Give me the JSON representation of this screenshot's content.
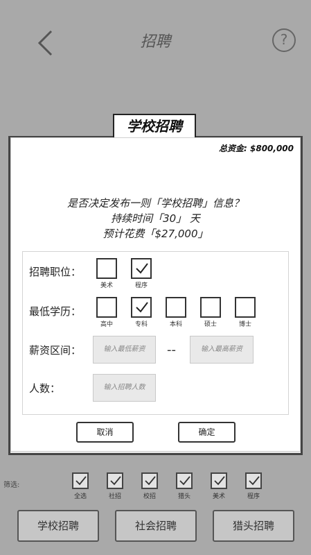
{
  "header": {
    "title": "招聘"
  },
  "dialog": {
    "tab_title": "学校招聘",
    "funds": "总资金: $800,000",
    "question_lines": [
      "是否决定发布一则「学校招聘」信息？",
      "持续时间「30」 天",
      "预计花费「$27,000」"
    ],
    "position": {
      "label": "招聘职位：",
      "options": [
        {
          "label": "美术",
          "checked": false
        },
        {
          "label": "程序",
          "checked": true
        }
      ]
    },
    "education": {
      "label": "最低学历：",
      "options": [
        {
          "label": "高中",
          "checked": false
        },
        {
          "label": "专科",
          "checked": true
        },
        {
          "label": "本科",
          "checked": false
        },
        {
          "label": "硕士",
          "checked": false
        },
        {
          "label": "博士",
          "checked": false
        }
      ]
    },
    "salary": {
      "label": "薪资区间：",
      "min_placeholder": "输入最低薪资",
      "separator": "--",
      "max_placeholder": "输入最高薪资"
    },
    "headcount": {
      "label": "人数：",
      "placeholder": "输入招聘人数"
    },
    "cancel": "取消",
    "confirm": "确定"
  },
  "filter": {
    "label": "筛选:",
    "options": [
      {
        "label": "全选",
        "checked": true
      },
      {
        "label": "社招",
        "checked": true
      },
      {
        "label": "校招",
        "checked": true
      },
      {
        "label": "猎头",
        "checked": true
      },
      {
        "label": "美术",
        "checked": true
      },
      {
        "label": "程序",
        "checked": true
      }
    ]
  },
  "bottom_tabs": [
    "学校招聘",
    "社会招聘",
    "猎头招聘"
  ]
}
